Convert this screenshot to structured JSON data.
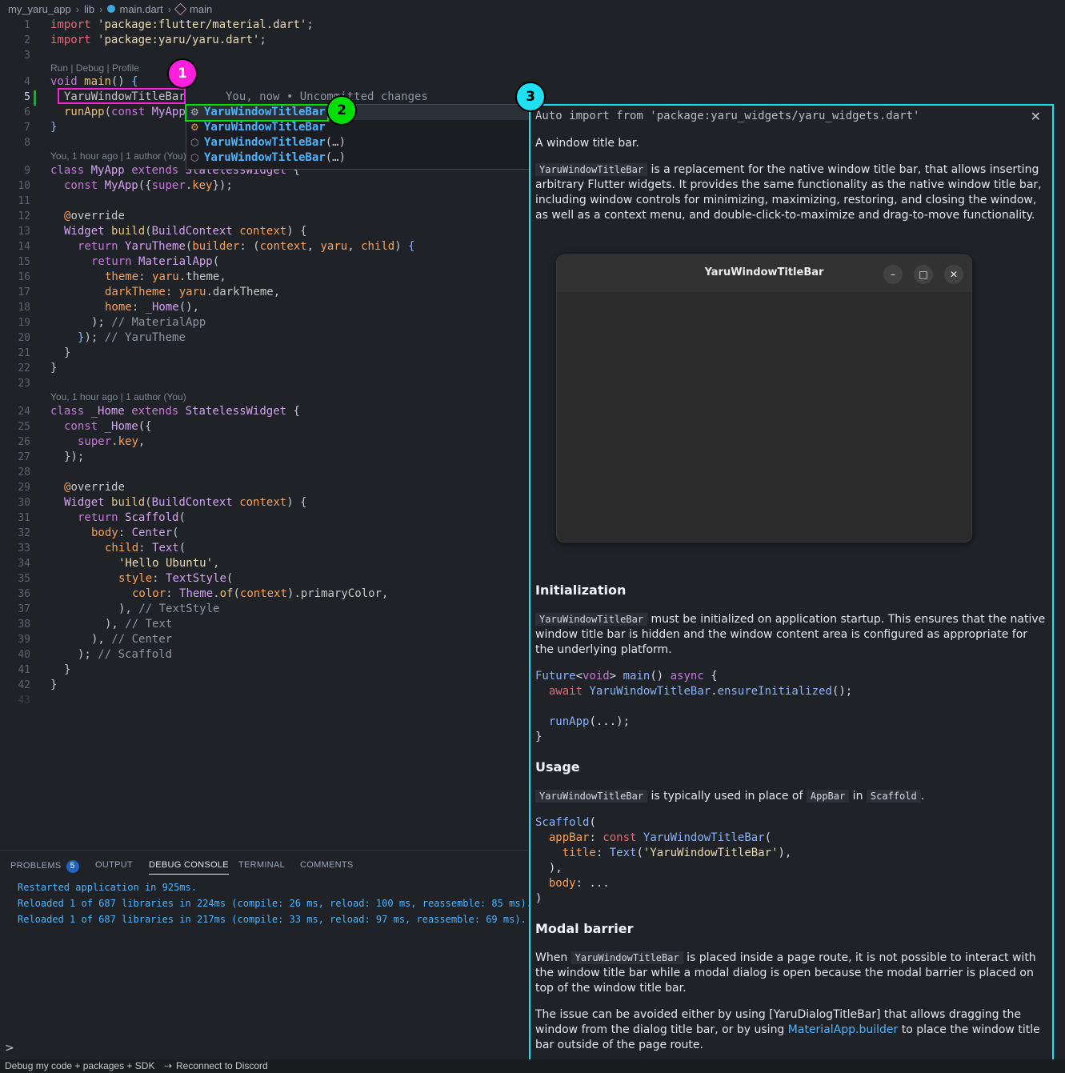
{
  "breadcrumb": {
    "items": [
      "my_yaru_app",
      "lib",
      "main.dart",
      "main"
    ]
  },
  "code_lenses": {
    "run_debug": "Run | Debug | Profile",
    "blame1": "You, 1 hour ago | 1 author (You)",
    "blame2": "You, 1 hour ago | 1 author (You)",
    "ghost": "You, now • Uncommitted changes"
  },
  "line_numbers": [
    "1",
    "2",
    "3",
    "4",
    "5",
    "6",
    "7",
    "8",
    "9",
    "10",
    "11",
    "12",
    "13",
    "14",
    "15",
    "16",
    "17",
    "18",
    "19",
    "20",
    "21",
    "22",
    "23",
    "24",
    "25",
    "26",
    "27",
    "28",
    "29",
    "30",
    "31",
    "32",
    "33",
    "34",
    "35",
    "36",
    "37",
    "38",
    "39",
    "40",
    "41",
    "42",
    "43"
  ],
  "suggestions": [
    {
      "name": "YaruWindowTitleBar",
      "suffix": "",
      "icon": "class-icon"
    },
    {
      "name": "YaruWindowTitleBar",
      "suffix": "",
      "icon": "class-icon"
    },
    {
      "name": "YaruWindowTitleBar",
      "suffix": "(…)",
      "icon": "constructor-icon"
    },
    {
      "name": "YaruWindowTitleBar",
      "suffix": "(…)",
      "icon": "constructor-icon"
    }
  ],
  "badges": {
    "b1": "1",
    "b2": "2",
    "b3": "3"
  },
  "docs": {
    "auto_import": "Auto import from 'package:yaru_widgets/yaru_widgets.dart'",
    "summary": "A window title bar.",
    "intro_code": "YaruWindowTitleBar",
    "intro_text": " is a replacement for the native window title bar, that allows inserting arbitrary Flutter widgets. It provides the same functionality as the native window title bar, including window controls for minimizing, maximizing, restoring, and closing the window, as well as a context menu, and double-click-to-maximize and drag-to-move functionality.",
    "preview_title": "YaruWindowTitleBar",
    "h_init": "Initialization",
    "init_code": "YaruWindowTitleBar",
    "init_text": " must be initialized on application startup. This ensures that the native window title bar is hidden and the window content area is configured as appropriate for the underlying platform.",
    "h_usage": "Usage",
    "usage_code1": "YaruWindowTitleBar",
    "usage_text1": " is typically used in place of ",
    "usage_code2": "AppBar",
    "usage_text2": " in ",
    "usage_code3": "Scaffold",
    "usage_text3": ".",
    "h_modal": "Modal barrier",
    "modal_when": "When ",
    "modal_code": "YaruWindowTitleBar",
    "modal_text": " is placed inside a page route, it is not possible to interact with the window title bar while a modal dialog is open because the modal barrier is placed on top of the window title bar.",
    "issue_text": "The issue can be avoided either by using [YaruDialogTitleBar] that allows dragging the window from the dialog title bar, or by using ",
    "issue_link": "MaterialApp.builder",
    "issue_text2": " to place the window title bar outside of the page route."
  },
  "panel": {
    "tabs": [
      "PROBLEMS",
      "OUTPUT",
      "DEBUG CONSOLE",
      "TERMINAL",
      "COMMENTS"
    ],
    "problems_count": "5",
    "console": [
      "Restarted application in 925ms.",
      "Reloaded 1 of 687 libraries in 224ms (compile: 26 ms, reload: 100 ms, reassemble: 85 ms).",
      "Reloaded 1 of 687 libraries in 217ms (compile: 33 ms, reload: 97 ms, reassemble: 69 ms)."
    ],
    "prompt": ">"
  },
  "status": {
    "left": "Debug my code + packages + SDK",
    "right": "Reconnect to Discord"
  },
  "colors": {
    "accent_pink": "#ff1fdc",
    "accent_green": "#00e000",
    "accent_cyan": "#1ee0f0"
  }
}
